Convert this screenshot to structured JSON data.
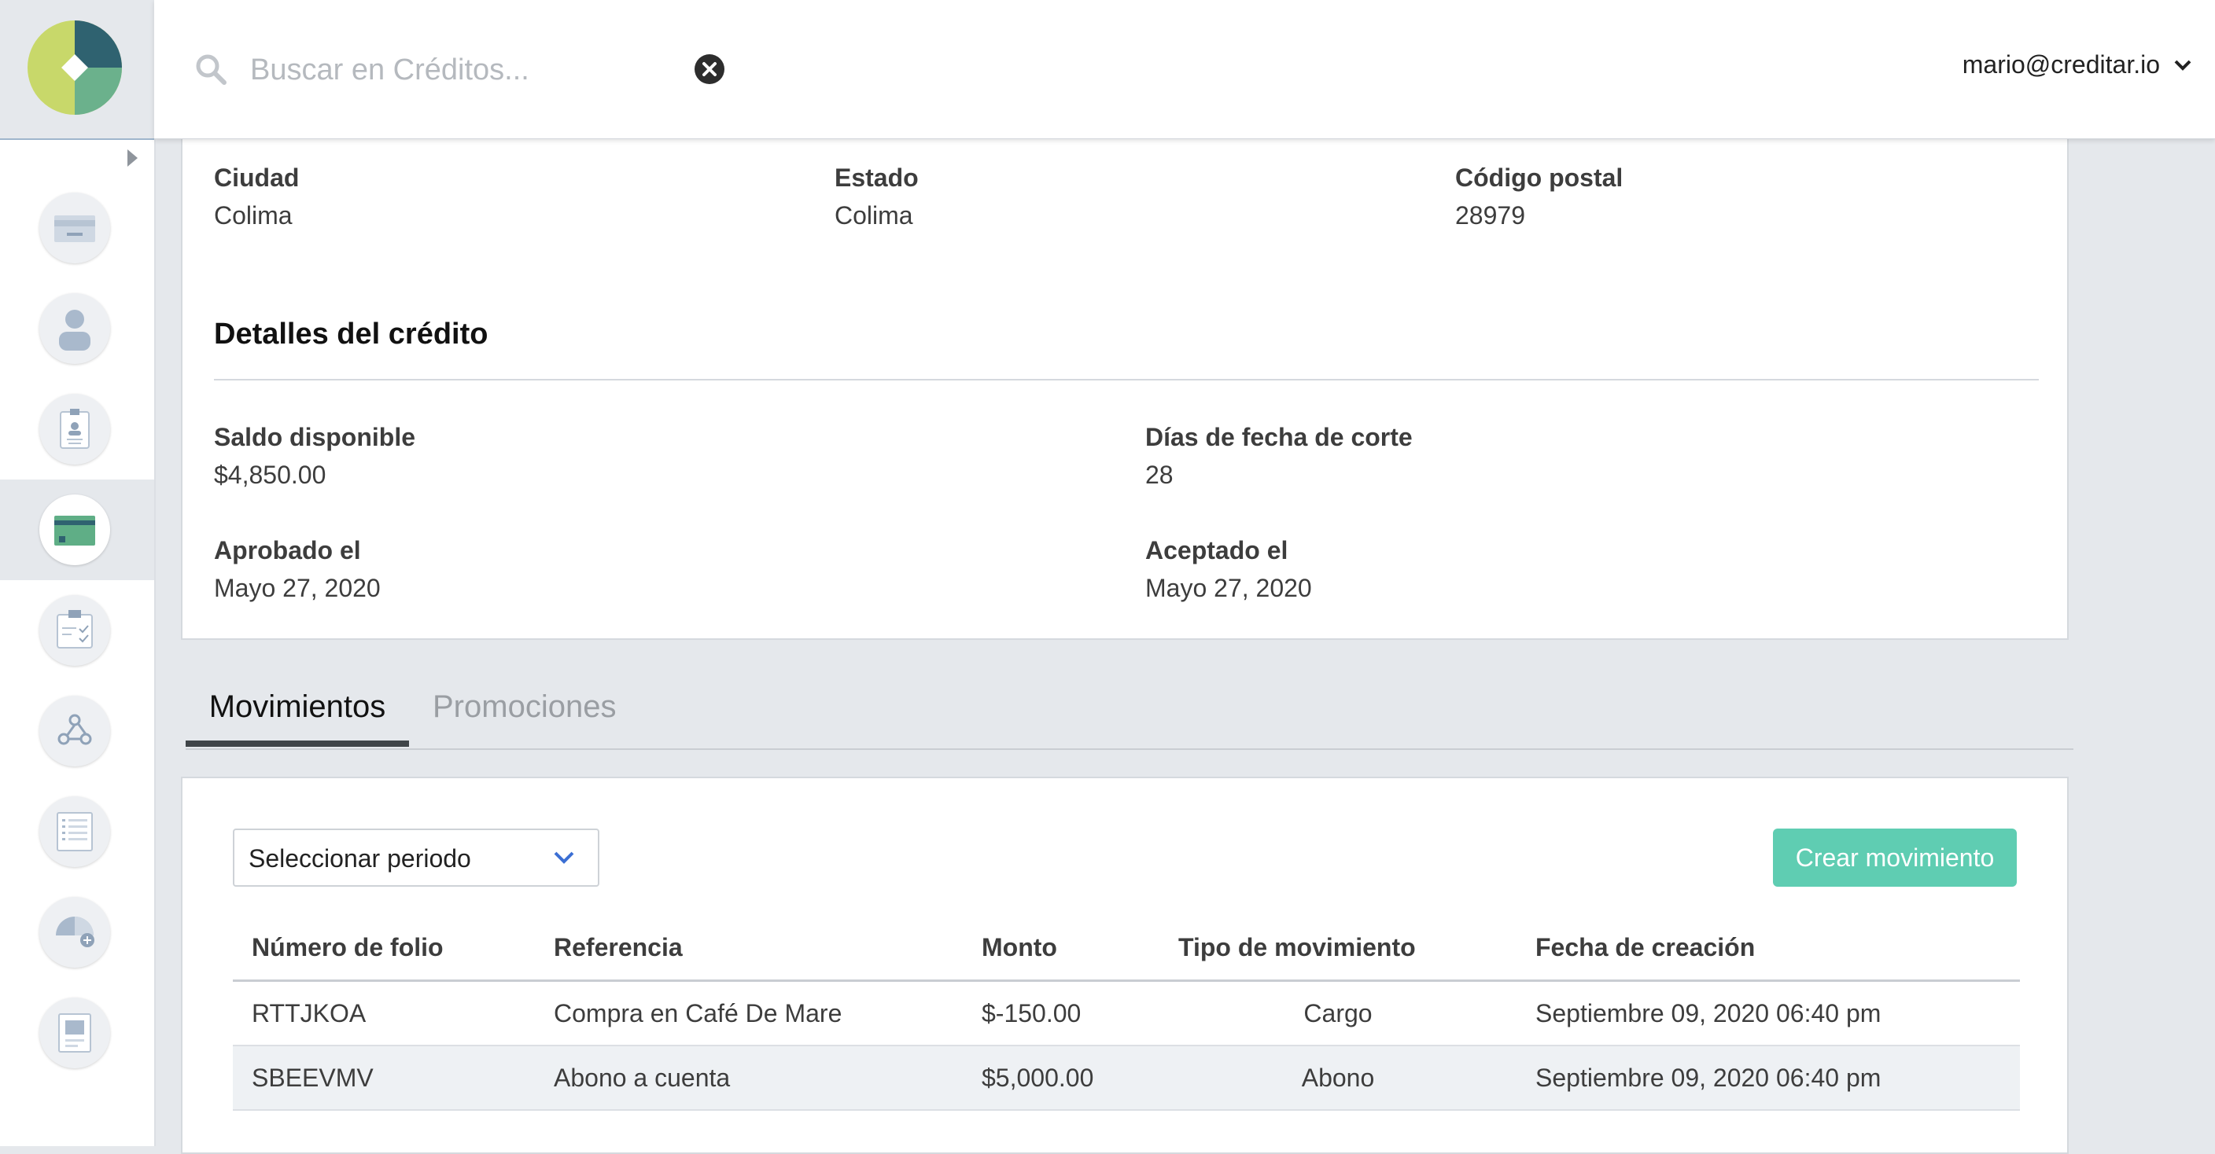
{
  "header": {
    "search_placeholder": "Buscar en Créditos...",
    "user_email": "mario@creditar.io"
  },
  "sidebar": {
    "items": [
      {
        "icon": "card-icon"
      },
      {
        "icon": "user-icon"
      },
      {
        "icon": "id-badge-icon"
      },
      {
        "icon": "credit-card-icon",
        "active": true
      },
      {
        "icon": "clipboard-check-icon"
      },
      {
        "icon": "webhook-icon"
      },
      {
        "icon": "list-icon"
      },
      {
        "icon": "gauge-add-icon"
      },
      {
        "icon": "document-icon"
      }
    ]
  },
  "address": {
    "city_label": "Ciudad",
    "city": "Colima",
    "state_label": "Estado",
    "state": "Colima",
    "zip_label": "Código postal",
    "zip": "28979"
  },
  "credit": {
    "title": "Detalles del crédito",
    "available_label": "Saldo disponible",
    "available": "$4,850.00",
    "cut_day_label": "Días de fecha de corte",
    "cut_day": "28",
    "approved_label": "Aprobado el",
    "approved": "Mayo 27, 2020",
    "accepted_label": "Aceptado el",
    "accepted": "Mayo 27, 2020"
  },
  "tabs": [
    "Movimientos",
    "Promociones"
  ],
  "movements": {
    "period_select": "Seleccionar periodo",
    "create_button": "Crear movimiento",
    "columns": [
      "Número de folio",
      "Referencia",
      "Monto",
      "Tipo de movimiento",
      "Fecha de creación"
    ],
    "rows": [
      {
        "folio": "RTTJKOA",
        "reference": "Compra en Café De Mare",
        "amount": "$-150.00",
        "type": "Cargo",
        "date": "Septiembre 09, 2020 06:40 pm"
      },
      {
        "folio": "SBEEVMV",
        "reference": "Abono a cuenta",
        "amount": "$5,000.00",
        "type": "Abono",
        "date": "Septiembre 09, 2020 06:40 pm"
      }
    ]
  },
  "colors": {
    "accent_button": "#5fcdb2",
    "negative_amount": "#e0415b",
    "positive_amount": "#4dbd56"
  }
}
